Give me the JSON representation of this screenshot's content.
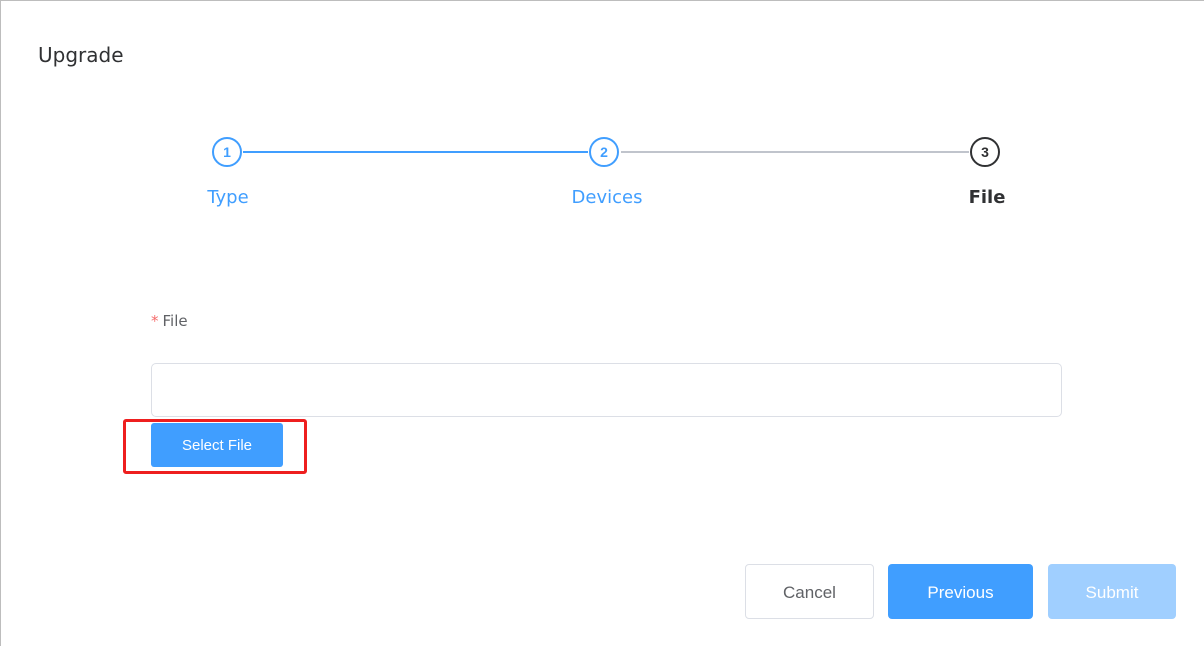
{
  "dialog": {
    "title": "Upgrade"
  },
  "steps": [
    {
      "number": "1",
      "label": "Type",
      "status": "done"
    },
    {
      "number": "2",
      "label": "Devices",
      "status": "done"
    },
    {
      "number": "3",
      "label": "File",
      "status": "current"
    }
  ],
  "form": {
    "required_mark": "*",
    "file_label": "File",
    "file_value": "",
    "select_file_label": "Select File"
  },
  "footer": {
    "cancel_label": "Cancel",
    "previous_label": "Previous",
    "submit_label": "Submit"
  },
  "colors": {
    "primary": "#409eff",
    "primary_disabled": "#a0cfff",
    "required": "#f56c6c",
    "highlight": "#ee1f1f",
    "text_dark": "#303133"
  }
}
